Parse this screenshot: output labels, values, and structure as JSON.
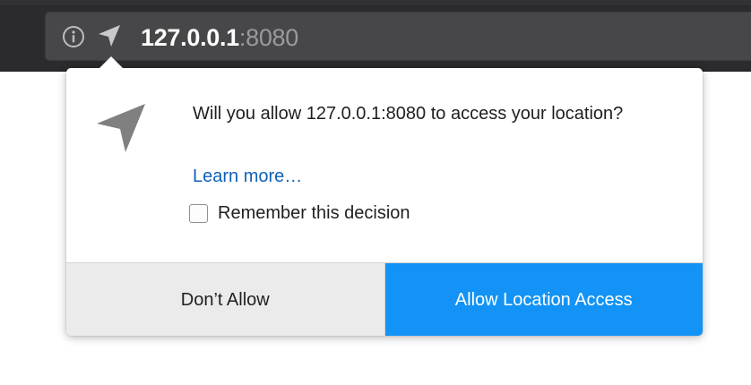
{
  "urlbar": {
    "host": "127.0.0.1",
    "port": ":8080",
    "icons": [
      "info-icon",
      "location-arrow-icon"
    ]
  },
  "permission_panel": {
    "icon": "location-arrow-icon",
    "message": "Will you allow 127.0.0.1:8080 to access your location?",
    "learn_more": "Learn more…",
    "remember_label": "Remember this decision",
    "remember_checked": false,
    "secondary_button": "Don’t Allow",
    "primary_button": "Allow Location Access"
  },
  "colors": {
    "toolbar_bg": "#2b2b2d",
    "urlbar_bg": "#474749",
    "link": "#1160b7",
    "primary_button": "#1293f5",
    "secondary_button": "#ebebeb"
  }
}
